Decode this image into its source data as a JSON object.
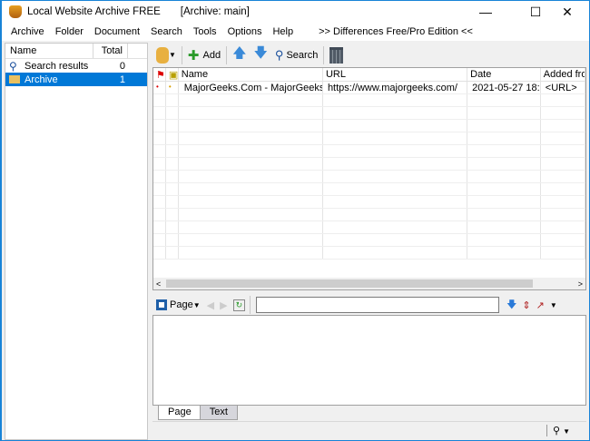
{
  "title": {
    "app": "Local Website Archive  FREE",
    "archive": "[Archive: main]",
    "minimize": "—",
    "maximize": "☐",
    "close": "✕"
  },
  "menu": [
    "Archive",
    "Folder",
    "Document",
    "Search",
    "Tools",
    "Options",
    "Help",
    ">> Differences Free/Pro Edition <<"
  ],
  "left": {
    "headers": [
      "Name",
      "Total"
    ],
    "items": [
      {
        "label": "Search results",
        "count": "0"
      },
      {
        "label": "Archive",
        "count": "1"
      }
    ]
  },
  "toolbar": {
    "add": "Add",
    "search": "Search"
  },
  "grid": {
    "headers": [
      "Name",
      "URL",
      "Date",
      "Added fro"
    ],
    "rows": [
      {
        "name": "MajorGeeks.Com - MajorGeeks",
        "url": "https://www.majorgeeks.com/",
        "date": "2021-05-27 18:...",
        "added": "<URL>"
      }
    ]
  },
  "viewer": {
    "page_menu": "Page",
    "address": ""
  },
  "tabs": [
    "Page",
    "Text"
  ],
  "colors": {
    "accent": "#0078d7"
  }
}
